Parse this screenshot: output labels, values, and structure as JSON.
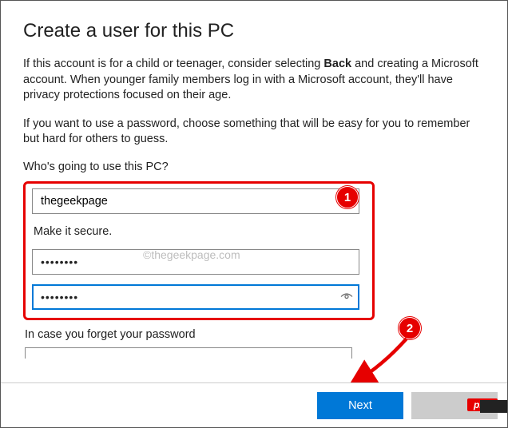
{
  "header": {
    "title": "Create a user for this PC"
  },
  "intro": {
    "part1": "If this account is for a child or teenager, consider selecting ",
    "bold": "Back",
    "part2": " and creating a Microsoft account. When younger family members log in with a Microsoft account, they'll have privacy protections focused on their age."
  },
  "password_hint": "If you want to use a password, choose something that will be easy for you to remember but hard for others to guess.",
  "labels": {
    "who_uses": "Who's going to use this PC?",
    "make_secure": "Make it secure.",
    "forget": "In case you forget your password"
  },
  "fields": {
    "username": "thegeekpage",
    "password": "••••••••",
    "confirm_password": "••••••••"
  },
  "watermark": "©thegeekpage.com",
  "callouts": {
    "one": "1",
    "two": "2"
  },
  "buttons": {
    "next": "Next",
    "back": ""
  },
  "badge": "php"
}
